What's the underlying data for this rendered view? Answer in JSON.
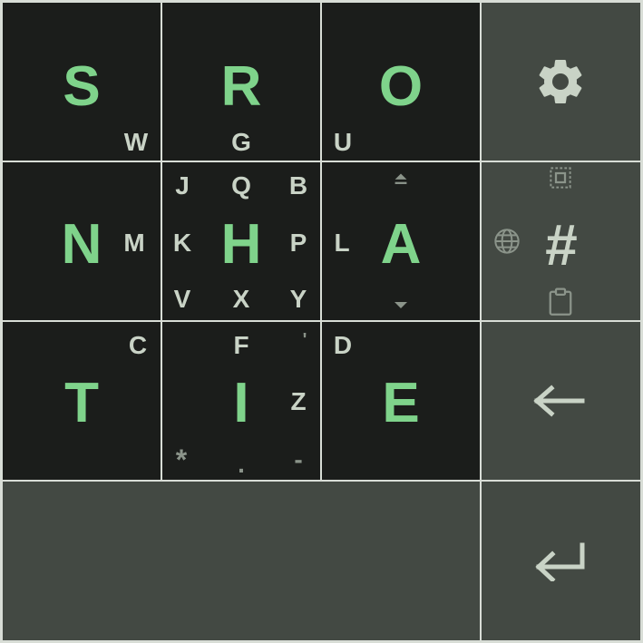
{
  "keys": {
    "s": {
      "main": "S",
      "se": "W"
    },
    "r": {
      "main": "R",
      "s": "G"
    },
    "o": {
      "main": "O",
      "sw": "U"
    },
    "n": {
      "main": "N",
      "e": "M"
    },
    "h": {
      "main": "H",
      "nw": "J",
      "n": "Q",
      "ne": "B",
      "w": "K",
      "e": "P",
      "sw": "V",
      "s": "X",
      "se": "Y"
    },
    "a": {
      "main": "A",
      "w": "L"
    },
    "t": {
      "main": "T",
      "ne": "C"
    },
    "i": {
      "main": "I",
      "n": "F",
      "ne": "'",
      "e": "Z",
      "sw": "*",
      "s": ".",
      "se": "-"
    },
    "e": {
      "main": "E",
      "nw": "D"
    },
    "numeric": {
      "label": "#"
    }
  },
  "icons": [
    "settings-gear-icon",
    "select-all-icon",
    "globe-icon",
    "clipboard-icon",
    "backspace-arrow-icon",
    "enter-arrow-icon",
    "caret-up-icon",
    "caret-down-icon"
  ],
  "colors": {
    "key_bg": "#1b1d1b",
    "side_key_bg": "#434943",
    "grid_line": "#d8ddd6",
    "accent_letter": "#7fd38b",
    "secondary_letter": "#c9d3c6",
    "dim_symbol": "#8b948a"
  }
}
